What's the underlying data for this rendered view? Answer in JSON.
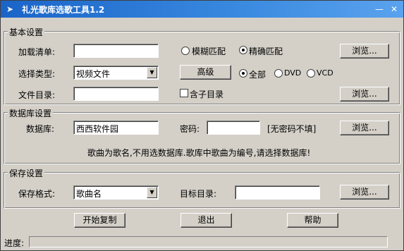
{
  "window": {
    "title": "礼光歌库选歌工具1.2",
    "min_label": "—",
    "close_label": "✕"
  },
  "basic": {
    "group_title": "基本设置",
    "load_list_label": "加载清单:",
    "load_list_value": "",
    "fuzzy_label": "模糊匹配",
    "exact_label": "精确匹配",
    "match_selected": "exact",
    "browse1_label": "浏览...",
    "type_label": "选择类型:",
    "type_selected": "视频文件",
    "advanced_label": "高级",
    "all_label": "全部",
    "dvd_label": "DVD",
    "vcd_label": "VCD",
    "media_selected": "all",
    "dir_label": "文件目录:",
    "dir_value": "",
    "subdir_label": "含子目录",
    "subdir_checked": false,
    "browse2_label": "浏览..."
  },
  "db": {
    "group_title": "数据库设置",
    "db_label": "数据库:",
    "db_value": "西西软件园",
    "pwd_label": "密码:",
    "pwd_value": "",
    "pwd_note": "[无密码不填]",
    "browse_label": "浏览...",
    "notice": "歌曲为歌名,不用选数据库.歌库中歌曲为编号,请选择数据库!"
  },
  "save": {
    "group_title": "保存设置",
    "format_label": "保存格式:",
    "format_selected": "歌曲名",
    "target_label": "目标目录:",
    "target_value": "",
    "browse_label": "浏览..."
  },
  "actions": {
    "start_label": "开始复制",
    "exit_label": "退出",
    "help_label": "帮助"
  },
  "status": {
    "progress_label": "进度:",
    "progress_fraction": 0
  }
}
